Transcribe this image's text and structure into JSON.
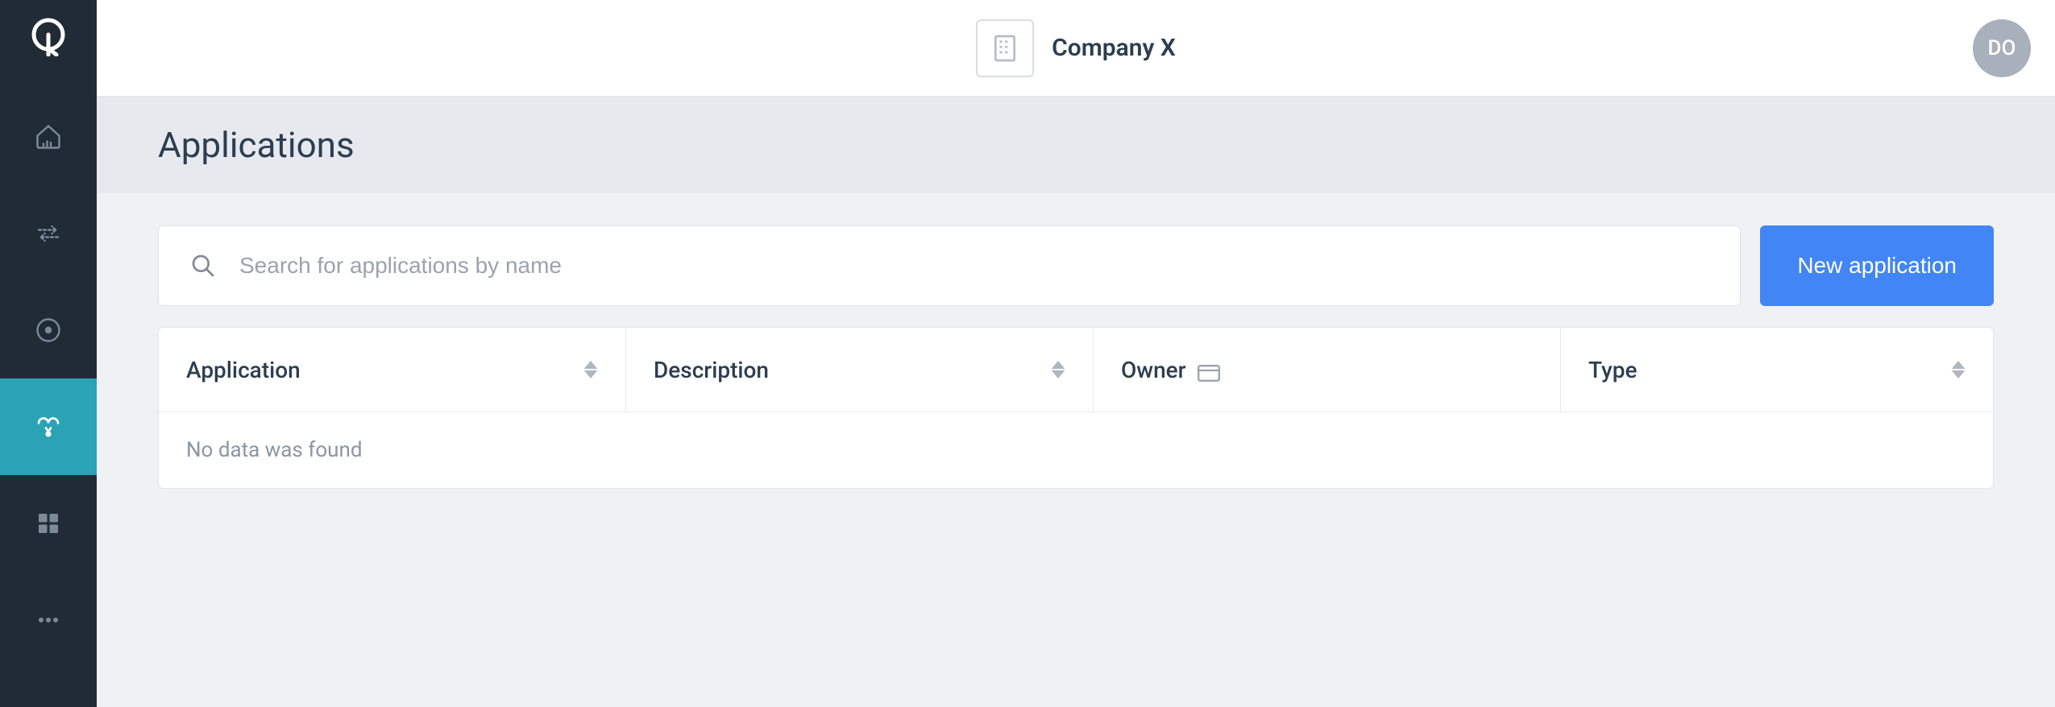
{
  "header": {
    "company_name": "Company X",
    "avatar_initials": "DO"
  },
  "page": {
    "title": "Applications"
  },
  "search": {
    "placeholder": "Search for applications by name",
    "value": ""
  },
  "buttons": {
    "new_application": "New application"
  },
  "table": {
    "columns": {
      "application": "Application",
      "description": "Description",
      "owner": "Owner",
      "type": "Type"
    },
    "empty_message": "No data was found",
    "rows": []
  }
}
